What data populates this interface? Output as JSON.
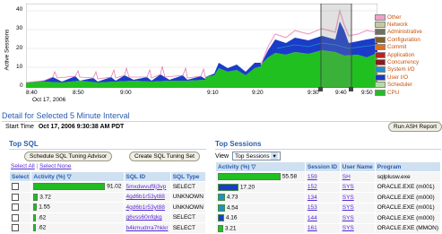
{
  "chart": {
    "ylabel": "Active Sessions",
    "yticks": [
      "40",
      "30",
      "20",
      "10",
      "0"
    ],
    "xticks": [
      "8:40",
      "8:50",
      "9:00",
      "9:10",
      "9:20",
      "9:30",
      "9:40",
      "9:50"
    ],
    "date_label": "Oct 17, 2006",
    "legend": [
      {
        "label": "Other",
        "color": "#f0a0c8"
      },
      {
        "label": "Network",
        "color": "#c8c8a0"
      },
      {
        "label": "Administrative",
        "color": "#707060"
      },
      {
        "label": "Configuration",
        "color": "#806020"
      },
      {
        "label": "Commit",
        "color": "#e07020"
      },
      {
        "label": "Application",
        "color": "#c02020"
      },
      {
        "label": "Concurrency",
        "color": "#8b1a1a"
      },
      {
        "label": "System I/O",
        "color": "#2090c8"
      },
      {
        "label": "User I/O",
        "color": "#1a3cc8"
      },
      {
        "label": "Scheduler",
        "color": "#b0e0a0"
      },
      {
        "label": "CPU",
        "color": "#20c020"
      }
    ]
  },
  "detail": {
    "title": "Detail for Selected 5 Minute Interval",
    "start_label": "Start Time",
    "start_value": "Oct 17, 2006 9:30:38 AM PDT",
    "report_button": "Run ASH Report"
  },
  "top_sql": {
    "title": "Top SQL",
    "btn_advisor": "Schedule SQL Tuning Advisor",
    "btn_set": "Create SQL Tuning Set",
    "select_all": "Select All",
    "select_none": "Select None",
    "columns": [
      "Select",
      "Activity (%)",
      "SQL ID",
      "SQL Type"
    ],
    "rows": [
      {
        "activity": "91.02",
        "sql_id": "5mxdwvuf9j3vp",
        "sql_type": "SELECT"
      },
      {
        "activity": "3.72",
        "sql_id": "4gd6b1r53yt88",
        "sql_type": "UNKNOWN"
      },
      {
        "activity": "1.55",
        "sql_id": "4gd6b1r53yt88",
        "sql_type": "UNKNOWN"
      },
      {
        "activity": ".62",
        "sql_id": "g6vss60nfqkg",
        "sql_type": "SELECT"
      },
      {
        "activity": ".62",
        "sql_id": "b4kmudrra7hkkr",
        "sql_type": "SELECT"
      }
    ],
    "bar_fraction": [
      0.91,
      0.037,
      0.016,
      0.006,
      0.006
    ]
  },
  "top_sessions": {
    "title": "Top Sessions",
    "view_label": "View",
    "view_value": "Top Sessions",
    "columns": [
      "Activity (%)",
      "Session ID",
      "User Name",
      "Program"
    ],
    "rows": [
      {
        "activity": "55.58",
        "sid": "159",
        "user": "SH",
        "program": "sqlplusw.exe",
        "color": "#20c020"
      },
      {
        "activity": "17.20",
        "sid": "152",
        "user": "SYS",
        "program": "ORACLE.EXE (m001)",
        "color": "#1a3cc8"
      },
      {
        "activity": "4.73",
        "sid": "134",
        "user": "SYS",
        "program": "ORACLE.EXE (m000)",
        "color": "#2090c8"
      },
      {
        "activity": "4.54",
        "sid": "153",
        "user": "SYS",
        "program": "ORACLE.EXE (m001)",
        "color": "#2090c8"
      },
      {
        "activity": "4.16",
        "sid": "144",
        "user": "SYS",
        "program": "ORACLE.EXE (m000)",
        "color": "#1a3cc8"
      },
      {
        "activity": "3.21",
        "sid": "161",
        "user": "SYS",
        "program": "ORACLE.EXE (MMON)",
        "color": "#20c020"
      }
    ],
    "bar_fraction": [
      0.556,
      0.172,
      0.047,
      0.045,
      0.042,
      0.032
    ]
  }
}
